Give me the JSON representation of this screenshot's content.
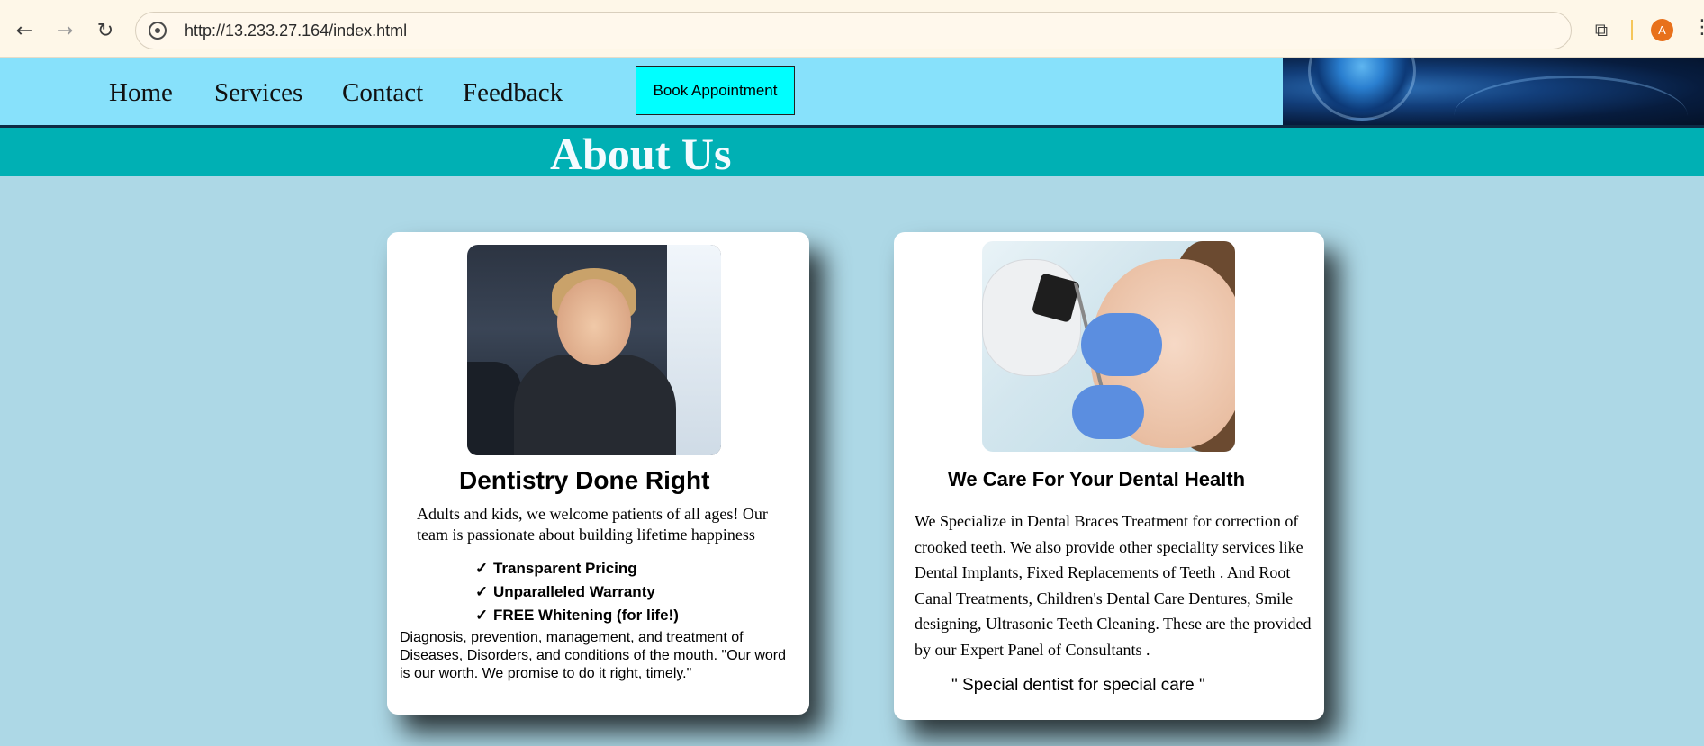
{
  "browser": {
    "back_icon": "←",
    "forward_icon": "→",
    "reload_icon": "↻",
    "url": "http://13.233.27.164/index.html",
    "extensions_icon": "⧉",
    "avatar_letter": "A",
    "menu_icon": "⋮"
  },
  "nav": {
    "links": [
      "Home",
      "Services",
      "Contact",
      "Feedback"
    ],
    "book_button": "Book Appointment"
  },
  "about": {
    "title": "About Us"
  },
  "card_left": {
    "title": "Dentistry Done Right",
    "intro": "Adults and kids, we welcome patients of all ages! Our team is passionate about building lifetime happiness",
    "check_mark": "✓",
    "features": [
      "Transparent Pricing",
      "Unparalleled Warranty",
      "FREE Whitening (for life!)"
    ],
    "diagnosis": "Diagnosis, prevention, management, and treatment of Diseases, Disorders, and conditions of the mouth. \"Our word is our worth. We promise to do it right, timely.\""
  },
  "card_right": {
    "title": "We Care For Your Dental Health",
    "body": "We Specialize in Dental Braces Treatment for correction of crooked teeth. We also provide other speciality services like Dental Implants, Fixed Replacements of Teeth . And Root Canal Treatments, Children's Dental Care Dentures, Smile designing, Ultrasonic Teeth Cleaning. These are the provided by our Expert Panel of Consultants .",
    "tagline": "\" Special dentist for special care \""
  },
  "colors": {
    "page_bg": "#add8e6",
    "nav_bg": "#87e1fb",
    "about_bar": "#00b0b4",
    "book_button": "#00ffff"
  }
}
